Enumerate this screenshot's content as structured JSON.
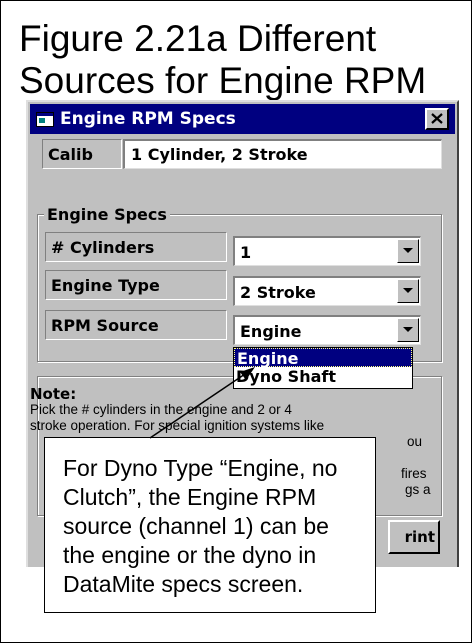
{
  "figure": {
    "title_line1": "Figure 2.21a  Different",
    "title_line2": "Sources for Engine RPM"
  },
  "window": {
    "title": "Engine RPM Specs",
    "close_label": "X"
  },
  "calib": {
    "label": "Calib",
    "value": "1 Cylinder,  2 Stroke"
  },
  "engine_specs": {
    "group_title": "Engine Specs",
    "cylinders": {
      "label": "# Cylinders",
      "value": "1"
    },
    "engine_type": {
      "label": "Engine Type",
      "value": "2 Stroke"
    },
    "rpm_source": {
      "label": "RPM Source",
      "value": "Engine",
      "options": [
        "Engine",
        "Dyno Shaft"
      ],
      "selected_index": 0
    }
  },
  "note": {
    "title": "Note:",
    "line1": "Pick the # cylinders in the engine and 2 or 4",
    "line2": "stroke operation.  For special ignition systems like",
    "line3_fragment": "ou",
    "line4_fragment": "fires",
    "line5_fragment": "gs a"
  },
  "print_button": {
    "label": "Print",
    "visible_text": "rint"
  },
  "callout": {
    "text": "For Dyno Type “Engine, no Clutch”, the Engine RPM source (channel 1) can be the engine or the dyno in DataMite specs screen."
  },
  "colors": {
    "titlebar": "#000080",
    "window_bg": "#c0c0c0",
    "selection": "#000080"
  }
}
